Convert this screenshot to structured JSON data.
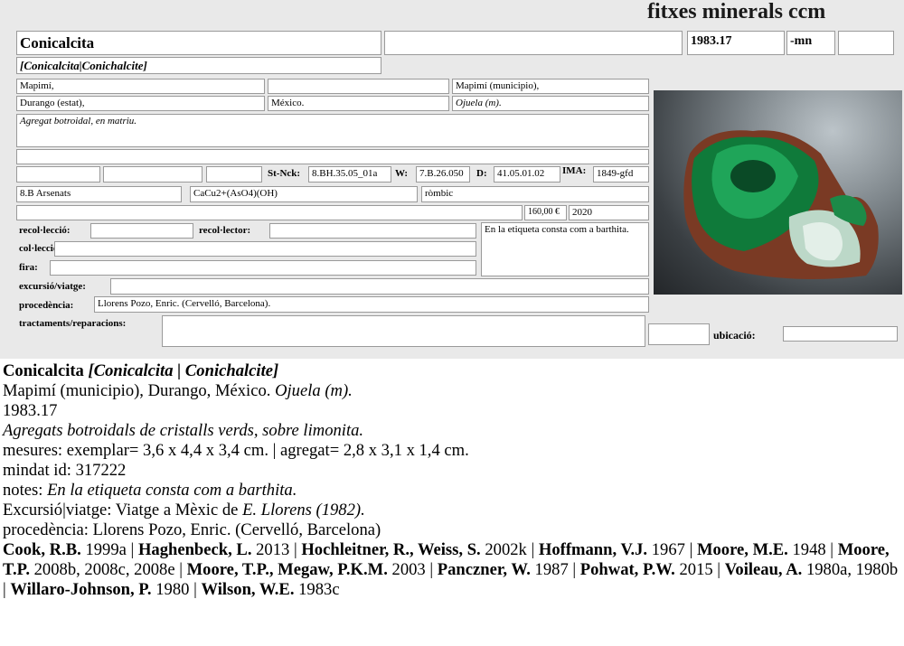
{
  "header": {
    "title": "fitxes minerals ccm"
  },
  "card": {
    "name": "Conicalcita",
    "catalog_number": "1983.17",
    "suffix": "-mn",
    "synonyms": "[Conicalcita|Conichalcite]",
    "locality": {
      "l1a": "Mapimí,",
      "l1c": "Mapimí (municipio),",
      "l2a": "Durango (estat),",
      "l2b": "México.",
      "l2c": "Ojuela (m)."
    },
    "description": "Agregat botroidal, en matriu.",
    "st_nck_label": "St-Nck:",
    "st_nck_value": "8.BH.35.05_01a",
    "w_label": "W:",
    "w_value": "7.B.26.050",
    "d_label": "D:",
    "d_value": "41.05.01.02",
    "ima_label": "IMA:",
    "ima_value": "1849-gfd",
    "group": "8.B Arsenats",
    "formula": "CaCu2+(AsO4)(OH)",
    "system": "ròmbic",
    "price": "160,00 €",
    "year": "2020",
    "labels": {
      "recoleccio": "recol·lecció:",
      "recolector": "recol·lector:",
      "colleccio": "col·leccio:",
      "fira": "fira:",
      "excursio": "excursió/viatge:",
      "procedencia": "procedència:",
      "tractaments": "tractaments/reparacions:",
      "ubicacio": "ubicació:"
    },
    "notes": "En la etiqueta consta com a barthita.",
    "procedencia_value": "Llorens Pozo, Enric. (Cervelló, Barcelona).",
    "photo_icon": "mineral-specimen-photo"
  },
  "summary": {
    "name": "Conicalcita",
    "synonyms": "[Conicalcita | Conichalcite]",
    "locality_plain": "Mapimí (municipio), Durango, México.",
    "locality_italic": "Ojuela (m).",
    "catalog": "1983.17",
    "description": "Agregats botroidals de cristalls verds, sobre limonita.",
    "measures": "mesures: exemplar= 3,6 x 4,4 x 3,4 cm. | agregat= 2,8 x 3,1 x 1,4 cm.",
    "mindat": "mindat id: 317222",
    "notes_label": "notes:",
    "notes_text": "En la etiqueta consta com a barthita.",
    "excursio_label": "Excursió|viatge: Viatge a Mèxic de",
    "excursio_italic": "E. Llorens  (1982).",
    "procedencia": "procedència: Llorens Pozo, Enric. (Cervelló, Barcelona)",
    "refs": [
      {
        "author": "Cook, R.B.",
        "year": "1999a"
      },
      {
        "author": "Haghenbeck, L.",
        "year": "2013"
      },
      {
        "author": "Hochleitner, R., Weiss, S.",
        "year": "2002k"
      },
      {
        "author": "Hoffmann, V.J.",
        "year": "1967"
      },
      {
        "author": "Moore, M.E.",
        "year": "1948"
      },
      {
        "author": "Moore, T.P.",
        "year": "2008b, 2008c, 2008e"
      },
      {
        "author": "Moore, T.P., Megaw, P.K.M.",
        "year": "2003"
      },
      {
        "author": "Panczner, W.",
        "year": "1987"
      },
      {
        "author": "Pohwat, P.W.",
        "year": "2015"
      },
      {
        "author": "Voileau, A.",
        "year": "1980a, 1980b"
      },
      {
        "author": "Willaro-Johnson, P.",
        "year": "1980"
      },
      {
        "author": "Wilson, W.E.",
        "year": "1983c"
      }
    ]
  }
}
